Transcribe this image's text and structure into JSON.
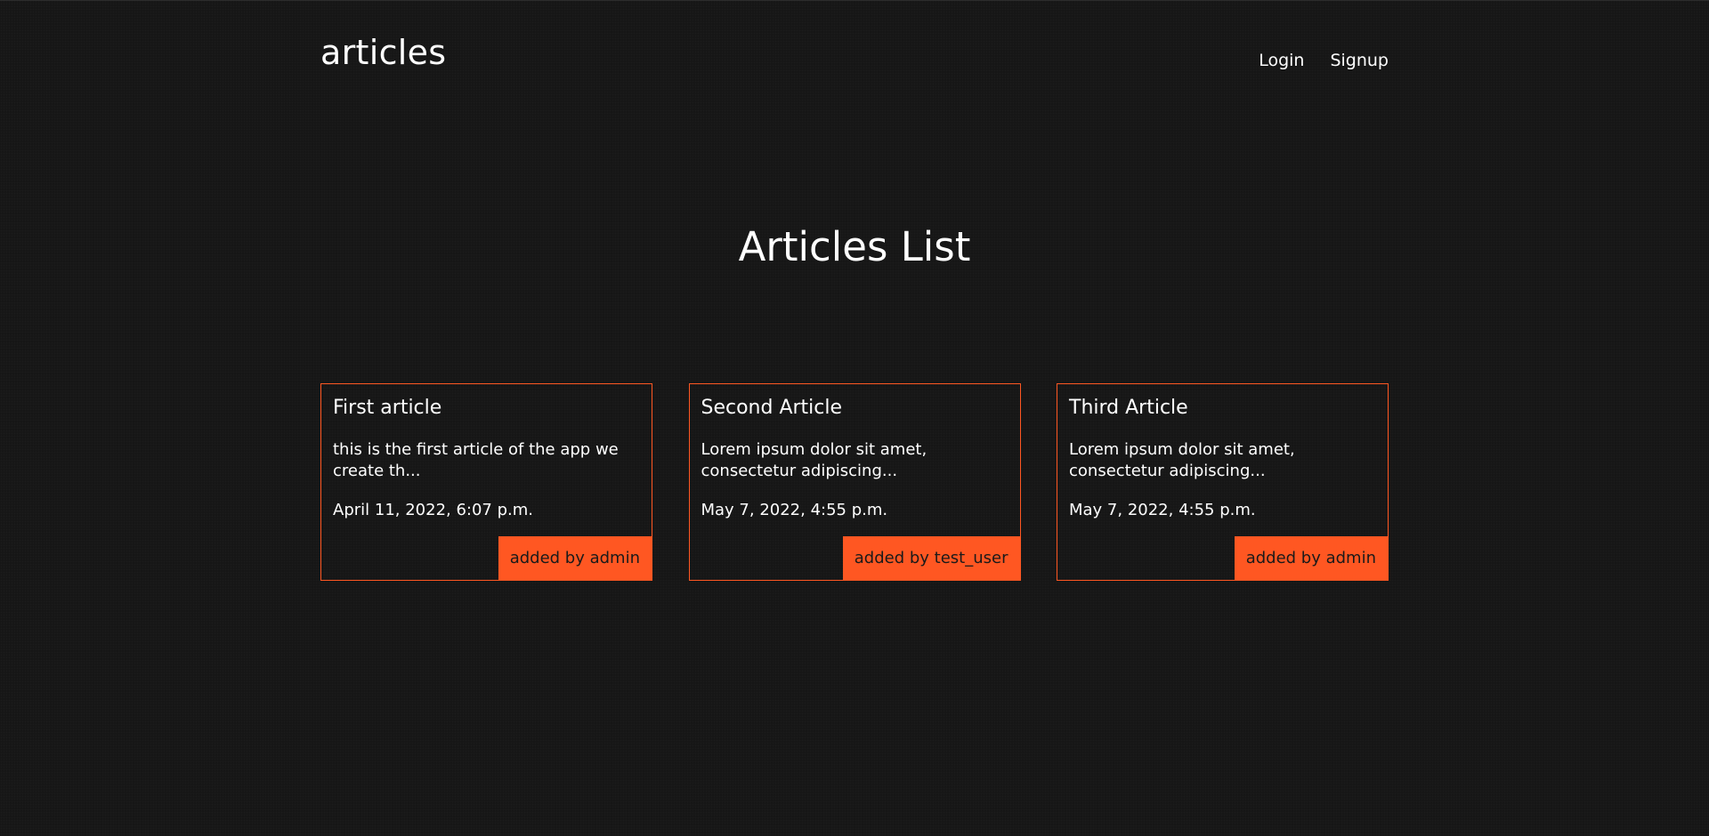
{
  "header": {
    "brand": "articles",
    "nav": [
      {
        "label": "Login"
      },
      {
        "label": "Signup"
      }
    ]
  },
  "main": {
    "title": "Articles List",
    "articles": [
      {
        "title": "First article",
        "snippet": "this is the first article of the app we create th...",
        "date": "April 11, 2022, 6:07 p.m.",
        "author": "added by admin"
      },
      {
        "title": "Second Article",
        "snippet": "Lorem ipsum dolor sit amet, consectetur adipiscing...",
        "date": "May 7, 2022, 4:55 p.m.",
        "author": "added by test_user"
      },
      {
        "title": "Third Article",
        "snippet": "Lorem ipsum dolor sit amet, consectetur adipiscing...",
        "date": "May 7, 2022, 4:55 p.m.",
        "author": "added by admin"
      }
    ]
  },
  "colors": {
    "background": "#161616",
    "accent": "#ff5722",
    "text": "#ffffff"
  }
}
